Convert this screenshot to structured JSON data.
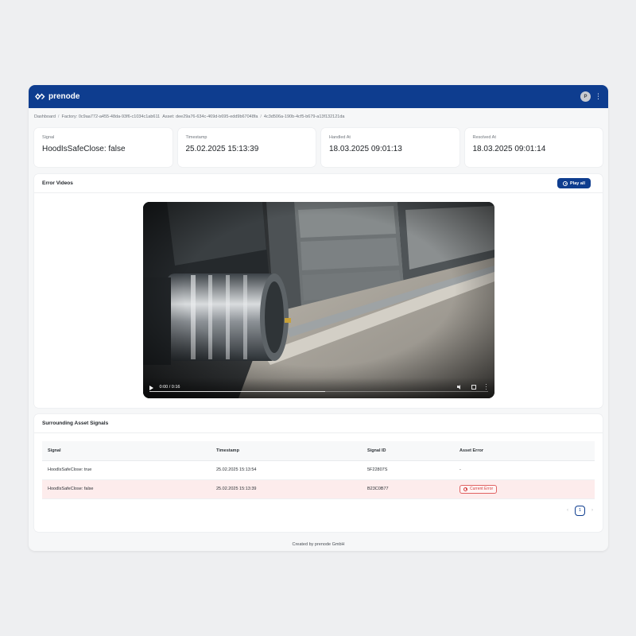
{
  "header": {
    "brand_name": "prenode",
    "avatar_initial": "P"
  },
  "breadcrumb": {
    "home": "Dashboard",
    "factory": "Factory: 0c9aa772-a455-48da-93f6-c1034c1ab611",
    "asset": "Asset: dee29a76-634c-469d-b695-edd9b67048fa",
    "current": "4c3d506a-190b-4cf5-b679-a13f132121da"
  },
  "summary": {
    "signal_label": "Signal",
    "signal_value": "HoodIsSafeClose: false",
    "timestamp_label": "Timestamp",
    "timestamp_value": "25.02.2025 15:13:39",
    "handled_label": "Handled At",
    "handled_value": "18.03.2025 09:01:13",
    "resolved_label": "Resolved At",
    "resolved_value": "18.03.2025 09:01:14"
  },
  "error_videos": {
    "title": "Error Videos",
    "play_all_label": "Play all",
    "video_time": "0:00 / 0:16",
    "progress": 0.52
  },
  "signals": {
    "title": "Surrounding Asset Signals",
    "columns": [
      "Signal",
      "Timestamp",
      "Signal ID",
      "Asset Error"
    ],
    "rows": [
      {
        "signal": "HoodIsSafeClose: true",
        "timestamp": "25.02.2025 15:13:54",
        "signal_id": "5F22807S",
        "asset_error": "-"
      },
      {
        "signal": "HoodIsSafeClose: false",
        "timestamp": "25.02.2025 15:13:39",
        "signal_id": "B23C0B77",
        "asset_error": "Current Error"
      }
    ],
    "pagination": {
      "prev": "‹",
      "page": "1",
      "next": "›"
    }
  },
  "footer": {
    "text": "Created by prenode GmbH"
  },
  "colors": {
    "brand": "#0e3d8f",
    "error_row": "#fdecec",
    "error_badge": "#d43c3c"
  },
  "icons": {
    "logo": "prenode-logo-icon",
    "play": "play-circle-icon",
    "menu": "kebab-menu-icon",
    "error": "error-circle-icon"
  }
}
